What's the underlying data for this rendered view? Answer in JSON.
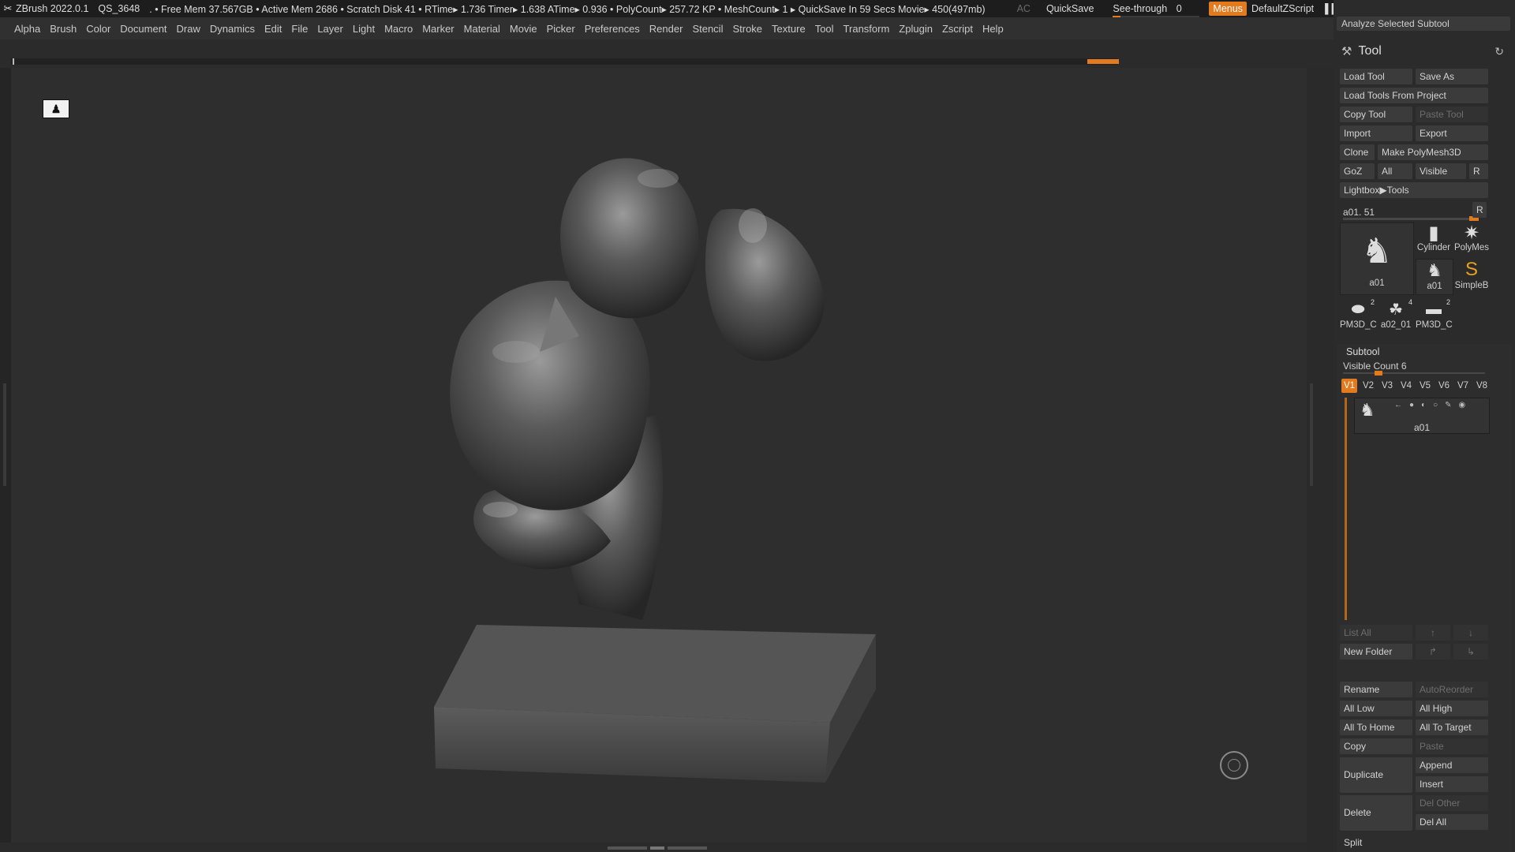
{
  "titlebar": {
    "app": "ZBrush 2022.0.1",
    "file": "QS_3648",
    "stats": ". • Free Mem 37.567GB • Active Mem 2686 • Scratch Disk 41 •  RTime▸ 1.736 Timer▸ 1.638 ATime▸ 0.936 • PolyCount▸ 257.72 KP  • MeshCount▸ 1  ▸ QuickSave In 59 Secs Movie▸ 450(497mb)",
    "ac": "AC",
    "quicksave": "QuickSave",
    "seethrough_label": "See-through",
    "seethrough_value": "0",
    "menus_label": "Menus",
    "script": "DefaultZScript"
  },
  "menubar": [
    "Alpha",
    "Brush",
    "Color",
    "Document",
    "Draw",
    "Dynamics",
    "Edit",
    "File",
    "Layer",
    "Light",
    "Macro",
    "Marker",
    "Material",
    "Movie",
    "Picker",
    "Preferences",
    "Render",
    "Stencil",
    "Stroke",
    "Texture",
    "Tool",
    "Transform",
    "Zplugin",
    "Zscript",
    "Help"
  ],
  "panel": {
    "top_button": "Analyze Selected Subtool",
    "title": "Tool",
    "buttons": {
      "load_tool": "Load Tool",
      "save_as": "Save As",
      "load_from_project": "Load Tools From Project",
      "copy_tool": "Copy Tool",
      "paste_tool": "Paste Tool",
      "import": "Import",
      "export": "Export",
      "clone": "Clone",
      "make_polymesh": "Make PolyMesh3D",
      "goz": "GoZ",
      "all": "All",
      "visible": "Visible",
      "r": "R",
      "lightbox_tools": "Lightbox▶Tools"
    },
    "slider": {
      "label": "a01. 51",
      "r": "R"
    },
    "thumbs": {
      "main": "a01",
      "cylinder": "Cylinder",
      "polymesh": "PolyMes",
      "small_a01": "a01",
      "simpleb": "SimpleB",
      "pm3d_1": "PM3D_C",
      "pm3d_1_count": "2",
      "a02": "a02_01",
      "a02_count": "4",
      "pm3d_2": "PM3D_C",
      "pm3d_2_count": "2"
    },
    "subtool": {
      "title": "Subtool",
      "visible_count": "Visible Count 6",
      "tabs": [
        "V1",
        "V2",
        "V3",
        "V4",
        "V5",
        "V6",
        "V7",
        "V8"
      ],
      "item_name": "a01",
      "buttons": {
        "list_all": "List All",
        "new_folder": "New Folder",
        "rename": "Rename",
        "autoreorder": "AutoReorder",
        "all_low": "All Low",
        "all_high": "All High",
        "all_to_home": "All To Home",
        "all_to_target": "All To Target",
        "copy": "Copy",
        "paste": "Paste",
        "duplicate": "Duplicate",
        "append": "Append",
        "insert": "Insert",
        "delete": "Delete",
        "del_other": "Del Other",
        "del_all": "Del All",
        "split": "Split"
      }
    }
  },
  "colors": {
    "accent": "#e27a1f",
    "panel_bg": "#2b2b2b",
    "button_bg": "#3b3b3b"
  },
  "icons": [
    "zbrush-logo-icon",
    "hammer-icon",
    "refresh-icon",
    "badge-icon",
    "circle-gizmo-icon",
    "eye-icon",
    "brush-icon"
  ]
}
